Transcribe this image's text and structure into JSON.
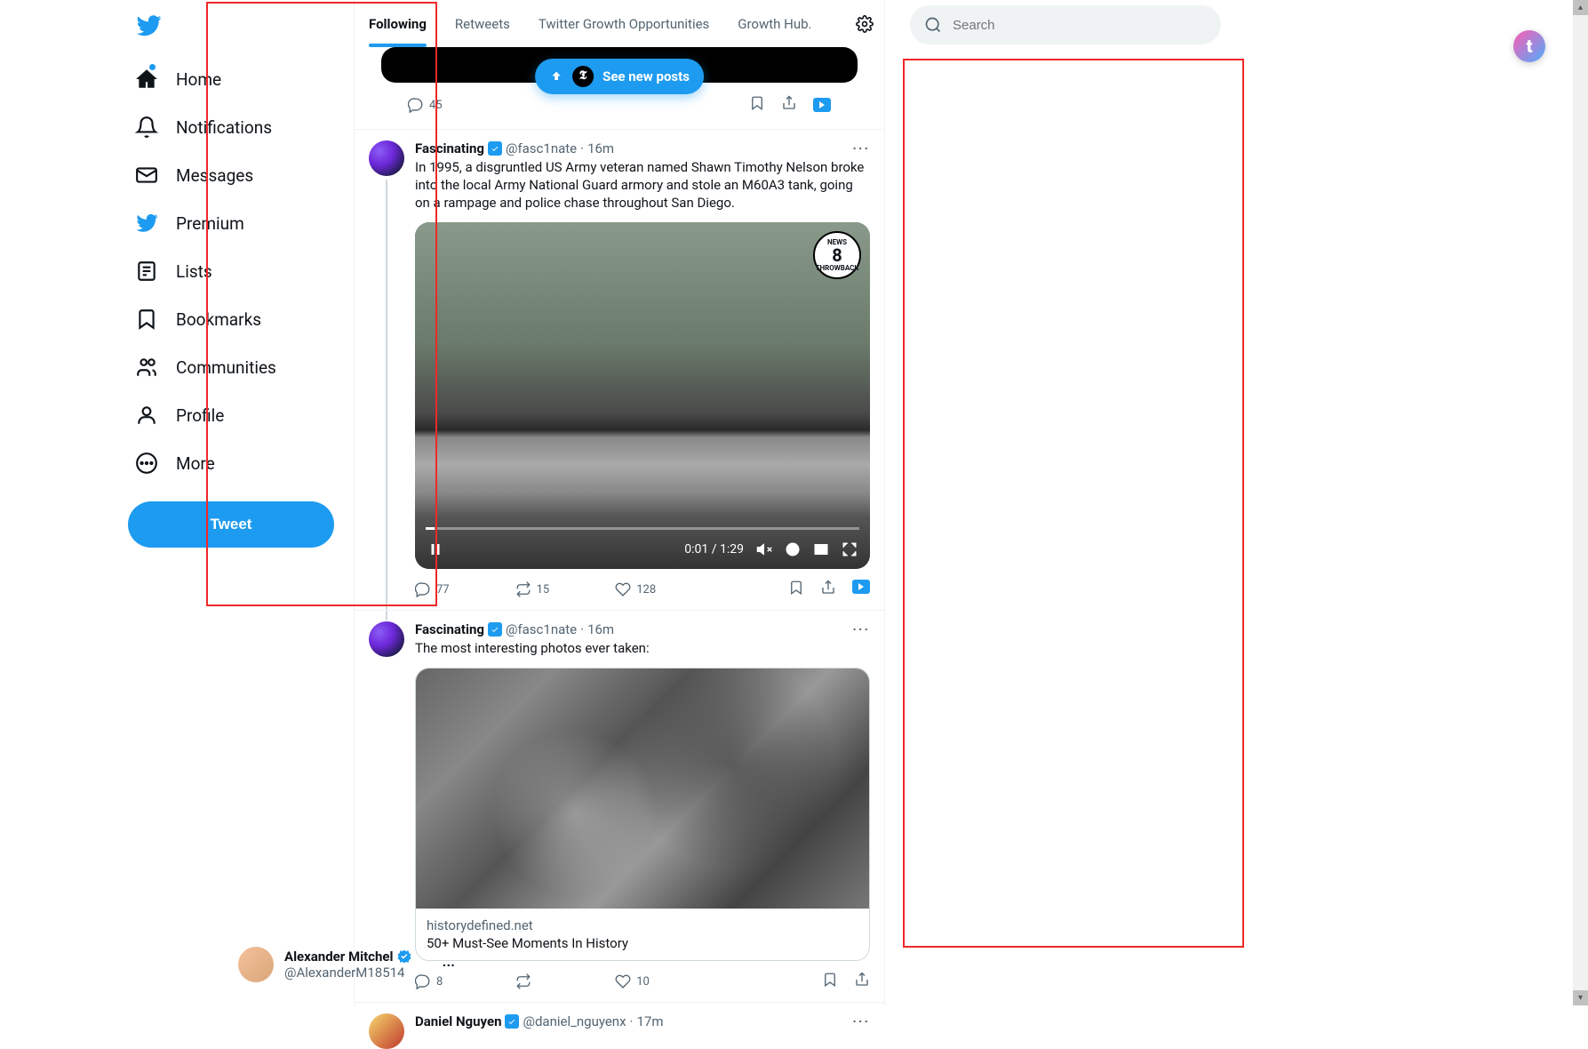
{
  "sidebar": {
    "items": [
      {
        "label": "Home"
      },
      {
        "label": "Notifications"
      },
      {
        "label": "Messages"
      },
      {
        "label": "Premium"
      },
      {
        "label": "Lists"
      },
      {
        "label": "Bookmarks"
      },
      {
        "label": "Communities"
      },
      {
        "label": "Profile"
      },
      {
        "label": "More"
      }
    ],
    "tweet_button": "Tweet"
  },
  "tabs": {
    "items": [
      "Following",
      "Retweets",
      "Twitter Growth Opportunities",
      "Growth Hub."
    ],
    "active_index": 0
  },
  "new_posts_pill": {
    "label": "See new posts"
  },
  "prev_tweet": {
    "reply_count": "45"
  },
  "tweets": [
    {
      "author": "Fascinating",
      "handle": "@fasc1nate",
      "time": "16m",
      "text": "In 1995, a disgruntled US Army veteran named Shawn Timothy Nelson broke into the local Army National Guard armory and stole an M60A3 tank, going on a rampage and police chase throughout San Diego.",
      "video": {
        "time_display": "0:01 / 1:29",
        "badge_top": "NEWS",
        "badge_big": "8",
        "badge_bottom": "THROWBACK"
      },
      "actions": {
        "reply": "77",
        "retweet": "15",
        "like": "128"
      }
    },
    {
      "author": "Fascinating",
      "handle": "@fasc1nate",
      "time": "16m",
      "text": "The most interesting photos ever taken:",
      "card": {
        "domain": "historydefined.net",
        "title": "50+ Must-See Moments In History"
      },
      "actions": {
        "reply": "8",
        "retweet": "",
        "like": "10"
      }
    },
    {
      "author": "Daniel Nguyen",
      "handle": "@daniel_nguyenx",
      "time": "17m"
    }
  ],
  "search": {
    "placeholder": "Search"
  },
  "account": {
    "name": "Alexander Mitchel",
    "handle": "@AlexanderM18514"
  },
  "extension": {
    "glyph": "t"
  }
}
